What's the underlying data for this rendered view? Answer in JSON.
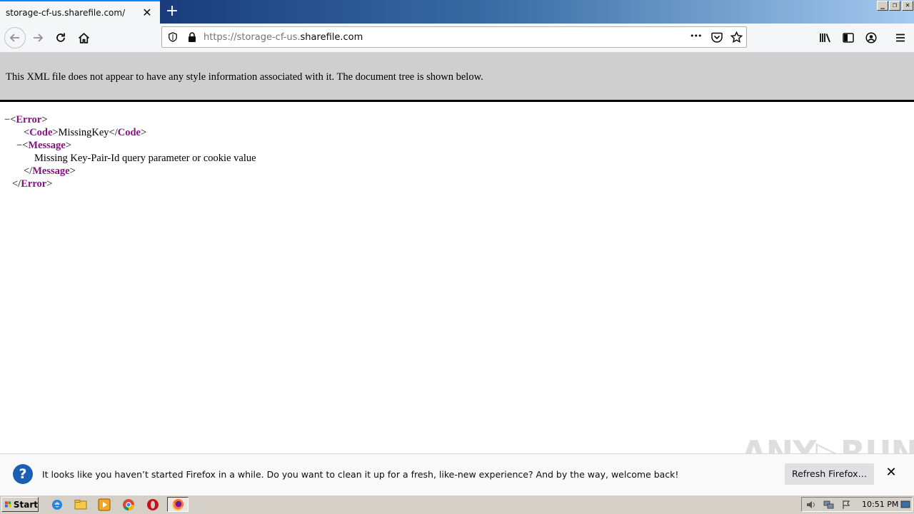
{
  "tab": {
    "title": "storage-cf-us.sharefile.com/",
    "close_glyph": "✕",
    "new_tab_glyph": "+"
  },
  "window_controls": {
    "minimize": "_",
    "restore": "❐",
    "close": "✕"
  },
  "urlbar": {
    "scheme_prefix": "https://storage-cf-us.",
    "host": "sharefile.com",
    "more_glyph": "•••"
  },
  "xml_banner": {
    "text": "This XML file does not appear to have any style information associated with it. The document tree is shown below."
  },
  "xml_tree": {
    "error_tag": "Error",
    "code_tag": "Code",
    "code_value": "MissingKey",
    "message_tag": "Message",
    "message_value": "Missing Key-Pair-Id query parameter or cookie value",
    "collapse_glyph": "−"
  },
  "notification": {
    "icon_glyph": "?",
    "text": "It looks like you haven’t started Firefox in a while. Do you want to clean it up for a fresh, like-new experience? And by the way, welcome back!",
    "button_label": "Refresh Firefox…",
    "close_glyph": "✕"
  },
  "watermark": {
    "text": "ANY▷RUN"
  },
  "taskbar": {
    "start_label": "Start",
    "clock": "10:51 PM"
  },
  "colors": {
    "xml_tag": "#881280",
    "titlebar_start": "#0a246a",
    "tab_accent": "#0a84ff",
    "info_icon": "#1a5fb4"
  }
}
